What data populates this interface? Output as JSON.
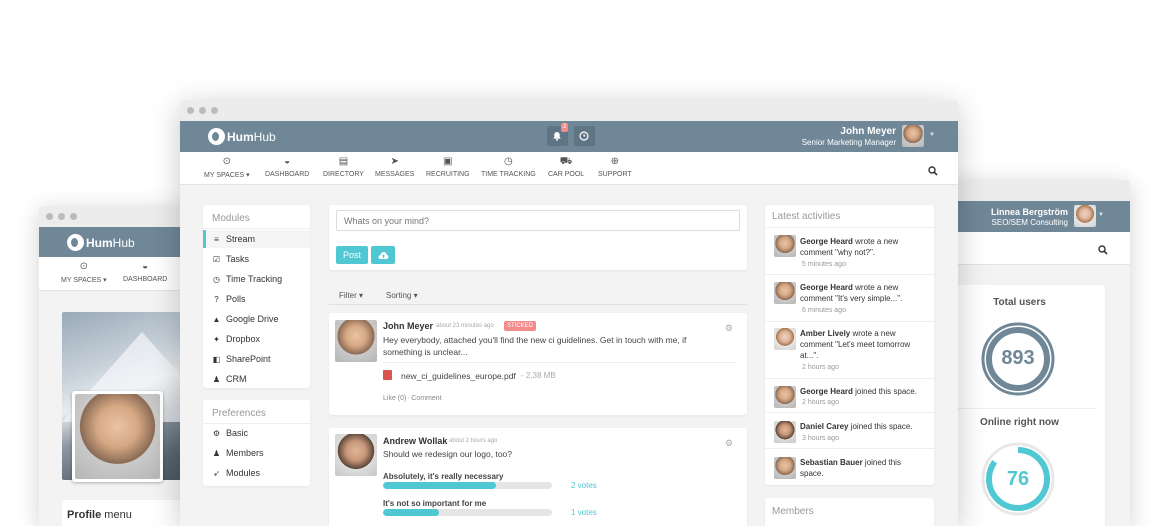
{
  "left_window": {
    "app_name_bold": "Hum",
    "app_name_rest": "Hub",
    "nav": [
      {
        "icon": "compass-icon",
        "glyph": "⊙",
        "label": "MY SPACES ▾"
      },
      {
        "icon": "dashboard-icon",
        "glyph": "◒",
        "label": "DASHBOARD"
      }
    ],
    "profile_menu_bold": "Profile",
    "profile_menu_rest": " menu"
  },
  "main_window": {
    "app_name_bold": "Hum",
    "app_name_rest": "Hub",
    "notification_count": "2",
    "user_name": "John Meyer",
    "user_title": "Senior Marketing Manager",
    "nav": [
      {
        "icon": "compass-icon",
        "glyph": "⊙",
        "label": "MY SPACES ▾"
      },
      {
        "icon": "dashboard-icon",
        "glyph": "◒",
        "label": "DASHBOARD"
      },
      {
        "icon": "directory-icon",
        "glyph": "▤",
        "label": "DIRECTORY"
      },
      {
        "icon": "send-icon",
        "glyph": "➤",
        "label": "MESSAGES"
      },
      {
        "icon": "linkedin-icon",
        "glyph": "▣",
        "label": "RECRUITING"
      },
      {
        "icon": "clock-icon",
        "glyph": "◷",
        "label": "TIME TRACKING"
      },
      {
        "icon": "car-icon",
        "glyph": "⛟",
        "label": "CAR POOL"
      },
      {
        "icon": "support-icon",
        "glyph": "⊕",
        "label": "SUPPORT"
      }
    ],
    "modules_header": "Modules",
    "modules": [
      {
        "icon": "list-icon",
        "glyph": "≡",
        "label": "Stream"
      },
      {
        "icon": "checkbox-icon",
        "glyph": "☑",
        "label": "Tasks"
      },
      {
        "icon": "clock-icon",
        "glyph": "◷",
        "label": "Time Tracking"
      },
      {
        "icon": "question-icon",
        "glyph": "?",
        "label": "Polls"
      },
      {
        "icon": "google-drive-icon",
        "glyph": "▲",
        "label": "Google Drive"
      },
      {
        "icon": "dropbox-icon",
        "glyph": "✦",
        "label": "Dropbox"
      },
      {
        "icon": "sharepoint-icon",
        "glyph": "◧",
        "label": "SharePoint"
      },
      {
        "icon": "user-icon",
        "glyph": "♟",
        "label": "CRM"
      }
    ],
    "preferences_header": "Preferences",
    "preferences": [
      {
        "icon": "gears-icon",
        "glyph": "⚙",
        "label": "Basic"
      },
      {
        "icon": "users-icon",
        "glyph": "♟",
        "label": "Members"
      },
      {
        "icon": "rocket-icon",
        "glyph": "➶",
        "label": "Modules"
      }
    ],
    "composer_placeholder": "Whats on your mind?",
    "post_button": "Post",
    "filter_label": "Filter ▾",
    "sorting_label": "Sorting ▾",
    "posts": [
      {
        "author": "John Meyer",
        "time": "about 23 minutes ago",
        "badge": "STICKED",
        "text": "Hey everybody, attached you'll find the new ci guidelines. Get in touch with me, if something is unclear...",
        "attachment": "new_ci_guidelines_europe.pdf",
        "attachment_size": " - 2,38 MB",
        "like": "Like (0)",
        "comment": " · Comment"
      },
      {
        "author": "Andrew Wollak",
        "time": "about 2 hours ago",
        "text": "Should we redesign our logo, too?",
        "poll": [
          {
            "answer": "Absolutely, it's really necessary",
            "votes": "2 votes",
            "fill": 0.67
          },
          {
            "answer": "It's not so important for me",
            "votes": "1 votes",
            "fill": 0.33
          }
        ]
      }
    ],
    "activities_header": "Latest activities",
    "activities": [
      {
        "name": "George Heard",
        "text": " wrote a new comment \"why not?\".",
        "time": "5 minutes ago"
      },
      {
        "name": "George Heard",
        "text": " wrote a new comment \"It's very simple...\".",
        "time": "6 minutes ago"
      },
      {
        "name": "Amber Lively",
        "text": " wrote a new comment \"Let's meet tomorrow at...\".",
        "time": "2 hours ago"
      },
      {
        "name": "George Heard",
        "text": " joined this space.",
        "time": "2 hours ago"
      },
      {
        "name": "Daniel Carey",
        "text": " joined this space.",
        "time": "3 hours ago"
      },
      {
        "name": "Sebastian Bauer",
        "text": " joined this space.",
        "time": ""
      }
    ],
    "members_header": "Members"
  },
  "right_window": {
    "user_name": "Linnea Bergström",
    "user_title": "SEO/SEM Consulting",
    "total_users_label": "Total users",
    "total_users": "893",
    "online_label": "Online right now",
    "online": "76",
    "online_fraction": 0.85
  },
  "colors": {
    "topbar": "#6f8797",
    "accent": "#4fc8d3",
    "gauge_dark": "#6f8797",
    "badge": "#f28b8b"
  }
}
